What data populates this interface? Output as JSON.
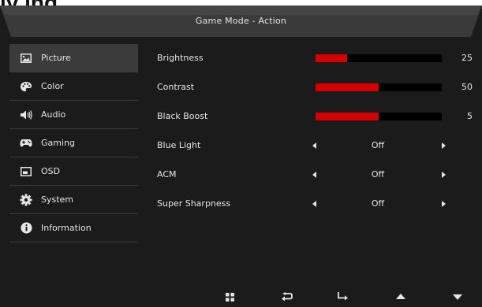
{
  "page_fragment": {
    "text": "ly ing"
  },
  "title_bar": {
    "title": "Game Mode - Action"
  },
  "sidebar": {
    "items": [
      {
        "label": "Picture",
        "icon": "picture-icon",
        "active": true
      },
      {
        "label": "Color",
        "icon": "palette-icon",
        "active": false
      },
      {
        "label": "Audio",
        "icon": "speaker-icon",
        "active": false
      },
      {
        "label": "Gaming",
        "icon": "gamepad-icon",
        "active": false
      },
      {
        "label": "OSD",
        "icon": "osd-window-icon",
        "active": false
      },
      {
        "label": "System",
        "icon": "gear-icon",
        "active": false
      },
      {
        "label": "Information",
        "icon": "info-icon",
        "active": false
      }
    ]
  },
  "settings": {
    "brightness": {
      "label": "Brightness",
      "value": "25",
      "fill_percent": 25
    },
    "contrast": {
      "label": "Contrast",
      "value": "50",
      "fill_percent": 50
    },
    "black_boost": {
      "label": "Black Boost",
      "value": "5",
      "fill_percent": 50
    },
    "blue_light": {
      "label": "Blue Light",
      "value": "Off"
    },
    "acm": {
      "label": "ACM",
      "value": "Off"
    },
    "super_sharpness": {
      "label": "Super Sharpness",
      "value": "Off"
    }
  },
  "footer": {
    "buttons": [
      "menu-grid-icon",
      "back-icon",
      "enter-icon",
      "up-icon",
      "down-icon"
    ]
  },
  "colors": {
    "accent_red": "#d40000",
    "panel_bg": "#1b1b1b",
    "active_item_bg": "#3b3b3b"
  }
}
